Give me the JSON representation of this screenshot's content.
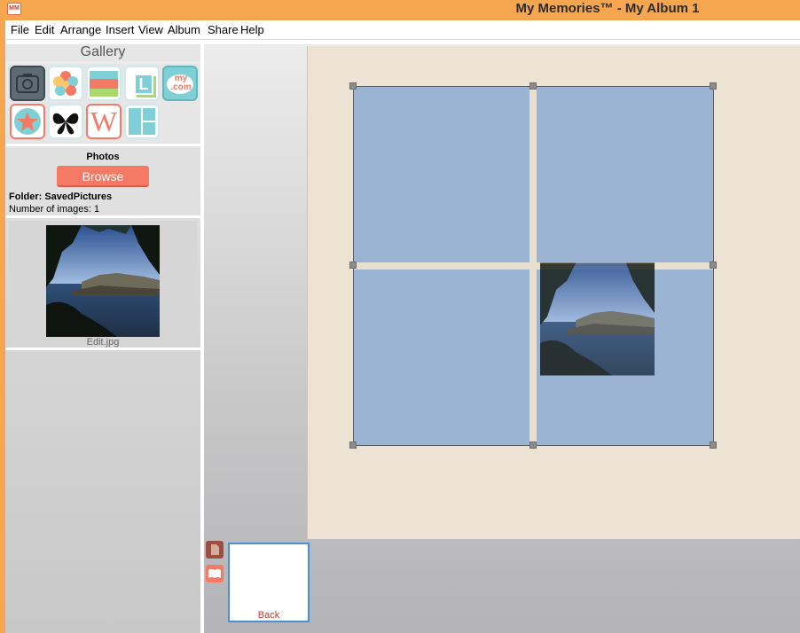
{
  "window": {
    "title": "My Memories™ - My Album 1",
    "app_icon_text": "MM"
  },
  "menu": [
    "File",
    "Edit",
    "Arrange",
    "Insert",
    "View",
    "Album",
    "Share",
    "Help"
  ],
  "gallery": {
    "title": "Gallery",
    "icons": [
      "camera-icon",
      "flower-icon",
      "stripes-icon",
      "letter-l-icon",
      "mycom-icon",
      "star-icon",
      "butterfly-icon",
      "letter-w-icon",
      "layout-icon"
    ],
    "mycom_text": "my\n.com",
    "l_letter": "L",
    "w_letter": "W"
  },
  "photos": {
    "label": "Photos",
    "browse_label": "Browse",
    "folder": "Folder: SavedPictures",
    "count": "Number of images: 1",
    "thumbnail_caption": "Edit.jpg"
  },
  "pages": {
    "back_label": "Back"
  },
  "colors": {
    "title_bar": "#f5a64f",
    "browse": "#f47a66",
    "frame_cell": "#9bb4d4",
    "page_bg": "#ece3d4"
  }
}
